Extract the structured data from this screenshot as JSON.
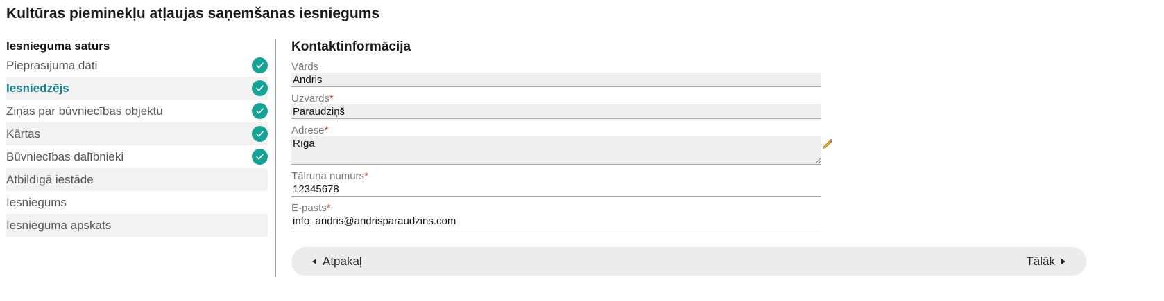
{
  "page_title": "Kultūras pieminekļu atļaujas saņemšanas iesniegums",
  "sidebar": {
    "heading": "Iesnieguma saturs",
    "items": [
      {
        "label": "Pieprasījuma dati",
        "completed": true
      },
      {
        "label": "Iesniedzējs",
        "completed": true,
        "active": true
      },
      {
        "label": "Ziņas par būvniecības objektu",
        "completed": true
      },
      {
        "label": "Kārtas",
        "completed": true
      },
      {
        "label": "Būvniecības dalībnieki",
        "completed": true
      },
      {
        "label": "Atbildīgā iestāde",
        "completed": false
      },
      {
        "label": "Iesniegums",
        "completed": false
      },
      {
        "label": "Iesnieguma apskats",
        "completed": false
      }
    ]
  },
  "form": {
    "section_title": "Kontaktinformācija",
    "fields": {
      "first_name": {
        "label": "Vārds",
        "value": "Andris"
      },
      "last_name": {
        "label": "Uzvārds",
        "required_mark": "*",
        "value": "Paraudziņš"
      },
      "address": {
        "label": "Adrese",
        "required_mark": "*",
        "value": "Rīga"
      },
      "phone": {
        "label": "Tālruņa numurs",
        "required_mark": "*",
        "value": "12345678"
      },
      "email": {
        "label": "E-pasts",
        "required_mark": "*",
        "value": "info_andris@andrisparaudzins.com"
      }
    }
  },
  "footer": {
    "back_label": "Atpakaļ",
    "next_label": "Tālāk"
  },
  "colors": {
    "accent": "#177e8a",
    "check": "#14a394",
    "required": "#c0392b"
  },
  "icons": {
    "completed": "check-circle-icon",
    "edit": "pencil-icon",
    "back": "triangle-left-icon",
    "next": "triangle-right-icon"
  }
}
